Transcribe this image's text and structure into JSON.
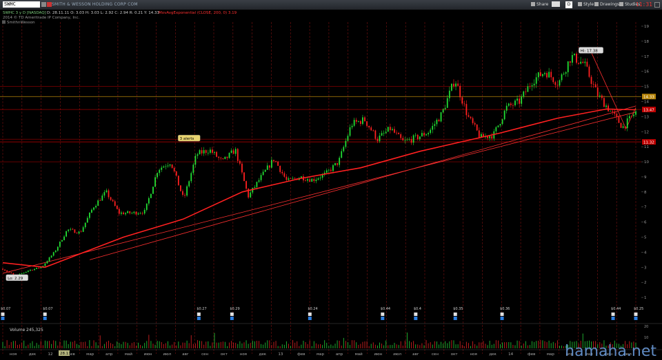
{
  "toolbar": {
    "symbol": "SWHC",
    "company": "SMITH & WESSON HOLDING CORP COM",
    "buttons": [
      "Share",
      "D",
      "Style",
      "Drawings",
      "Studies"
    ],
    "clock": "11:31"
  },
  "header": {
    "line1": {
      "symbol": "SWHC 3 y D [NASDAQ]",
      "ohlc": "D: 28.11.11  O: 3.03  H: 3.03  L: 2.92  C: 2.94  R: 0.21  Y: 14.33",
      "study": "MovAvgExponential (CLOSE, 200, 0) 3.19"
    },
    "line2": "2014 © TD Ameritrade IP Company, Inc.",
    "line3": "SmithnWesson"
  },
  "chart_data": {
    "type": "candlestick",
    "title": "SWHC 3 y D [NASDAQ]",
    "xlabel": "",
    "ylabel": "",
    "ylim": [
      0,
      19
    ],
    "y_ticks": [
      1,
      2,
      3,
      4,
      5,
      6,
      7,
      8,
      9,
      10,
      11,
      12,
      13,
      14,
      15,
      16,
      17,
      18,
      19
    ],
    "price_series": [
      [
        "2011-11-28",
        2.9
      ],
      [
        "2011-12-20",
        2.4
      ],
      [
        "2012-01-15",
        2.8
      ],
      [
        "2012-02-15",
        3.0
      ],
      [
        "2012-03-10",
        4.0
      ],
      [
        "2012-04-10",
        5.5
      ],
      [
        "2012-04-25",
        5.3
      ],
      [
        "2012-05-10",
        7.0
      ],
      [
        "2012-05-30",
        8.0
      ],
      [
        "2012-06-20",
        6.6
      ],
      [
        "2012-07-10",
        6.6
      ],
      [
        "2012-07-25",
        6.7
      ],
      [
        "2012-08-15",
        9.5
      ],
      [
        "2012-09-05",
        10.0
      ],
      [
        "2012-09-20",
        7.5
      ],
      [
        "2012-10-05",
        10.5
      ],
      [
        "2012-10-25",
        10.8
      ],
      [
        "2012-11-15",
        10.0
      ],
      [
        "2012-12-05",
        10.8
      ],
      [
        "2012-12-25",
        7.7
      ],
      [
        "2013-01-20",
        9.0
      ],
      [
        "2013-02-10",
        10.2
      ],
      [
        "2013-03-01",
        8.7
      ],
      [
        "2013-03-25",
        9.0
      ],
      [
        "2013-04-15",
        8.8
      ],
      [
        "2013-05-10",
        9.2
      ],
      [
        "2013-06-01",
        10.0
      ],
      [
        "2013-06-25",
        12.5
      ],
      [
        "2013-07-10",
        12.8
      ],
      [
        "2013-07-25",
        11.5
      ],
      [
        "2013-08-15",
        12.2
      ],
      [
        "2013-09-05",
        11.3
      ],
      [
        "2013-09-25",
        11.6
      ],
      [
        "2013-10-15",
        12.0
      ],
      [
        "2013-11-05",
        13.2
      ],
      [
        "2013-11-25",
        15.5
      ],
      [
        "2013-12-15",
        13.0
      ],
      [
        "2014-01-10",
        11.6
      ],
      [
        "2014-02-01",
        11.8
      ],
      [
        "2014-02-20",
        13.6
      ],
      [
        "2014-03-10",
        14.0
      ],
      [
        "2014-03-25",
        15.4
      ],
      [
        "2014-04-10",
        16.0
      ],
      [
        "2014-04-25",
        15.2
      ],
      [
        "2014-05-10",
        17.0
      ],
      [
        "2014-05-22",
        16.5
      ],
      [
        "2014-06-10",
        14.5
      ],
      [
        "2014-06-28",
        13.4
      ],
      [
        "2014-07-15",
        12.3
      ],
      [
        "2014-07-30",
        13.3
      ]
    ],
    "ema_200": [
      [
        "2011-11-28",
        3.3
      ],
      [
        "2012-02-01",
        3.0
      ],
      [
        "2012-06-01",
        5.0
      ],
      [
        "2012-09-01",
        6.2
      ],
      [
        "2012-12-01",
        8.0
      ],
      [
        "2013-03-01",
        8.9
      ],
      [
        "2013-06-01",
        9.6
      ],
      [
        "2013-09-01",
        10.7
      ],
      [
        "2014-01-01",
        11.9
      ],
      [
        "2014-04-01",
        12.9
      ],
      [
        "2014-06-15",
        13.5
      ],
      [
        "2014-07-30",
        13.45
      ]
    ],
    "trendlines": [
      {
        "from": [
          "2011-11-28",
          2.6
        ],
        "to": [
          "2014-07-30",
          13.3
        ]
      },
      {
        "from": [
          "2012-04-10",
          3.5
        ],
        "to": [
          "2014-07-30",
          13.7
        ]
      },
      {
        "from": [
          "2014-05-22",
          17.3
        ],
        "to": [
          "2014-07-15",
          12.2
        ]
      },
      {
        "from": [
          "2014-07-15",
          12.2
        ],
        "to": [
          "2014-07-30",
          13.6
        ]
      }
    ],
    "horizontal_levels": [
      {
        "value": 14.33,
        "label": "14.33",
        "color": "#b8860b"
      },
      {
        "value": 13.47,
        "label": "13.47",
        "color": "#c00000"
      },
      {
        "value": 11.32,
        "label": "11.32",
        "color": "#c00000"
      },
      {
        "value": 11.5,
        "label": "",
        "color": "#a00000"
      },
      {
        "value": 10.0,
        "label": "",
        "color": "#a00000"
      },
      {
        "value": 15.0,
        "label": "",
        "color": "#a00000"
      }
    ],
    "annotations": [
      {
        "text": "Hi: 17.38",
        "date": "2014-05-22",
        "value": 17.38
      },
      {
        "text": "Lo: 2.29",
        "date": "2011-12-20",
        "value": 2.29
      },
      {
        "text": "3 alerts",
        "date": "2012-09-10",
        "value": 11.55
      }
    ],
    "dividends": [
      {
        "date": "2011-11-28",
        "label": "$0.07"
      },
      {
        "date": "2012-02-01",
        "label": "$0.07"
      },
      {
        "date": "2012-09-25",
        "label": "$0.27"
      },
      {
        "date": "2012-11-15",
        "label": "$0.29"
      },
      {
        "date": "2013-03-15",
        "label": "$0.24"
      },
      {
        "date": "2013-07-05",
        "label": "$0.44"
      },
      {
        "date": "2013-08-25",
        "label": "$0.4"
      },
      {
        "date": "2013-10-25",
        "label": "$0.35"
      },
      {
        "date": "2014-01-05",
        "label": "$0.36"
      },
      {
        "date": "2014-06-25",
        "label": "$0.44"
      },
      {
        "date": "2014-07-30",
        "label": "$0.25"
      }
    ],
    "x_month_labels": [
      "ноя",
      "дек",
      "12",
      "фев",
      "мар",
      "апр",
      "май",
      "июн",
      "июл",
      "авг",
      "сен",
      "окт",
      "ноя",
      "дек",
      "13",
      "фев",
      "мар",
      "апр",
      "май",
      "июн",
      "июл",
      "авг",
      "сен",
      "окт",
      "ноя",
      "дек",
      "14",
      "фев",
      "мар",
      "апр",
      "май",
      "июн",
      "июл"
    ],
    "x_highlight": "28.11",
    "volume": {
      "label": "Volume",
      "value": "245,325",
      "ticks": [
        10,
        20
      ]
    },
    "watermark": "hamaha.net"
  }
}
